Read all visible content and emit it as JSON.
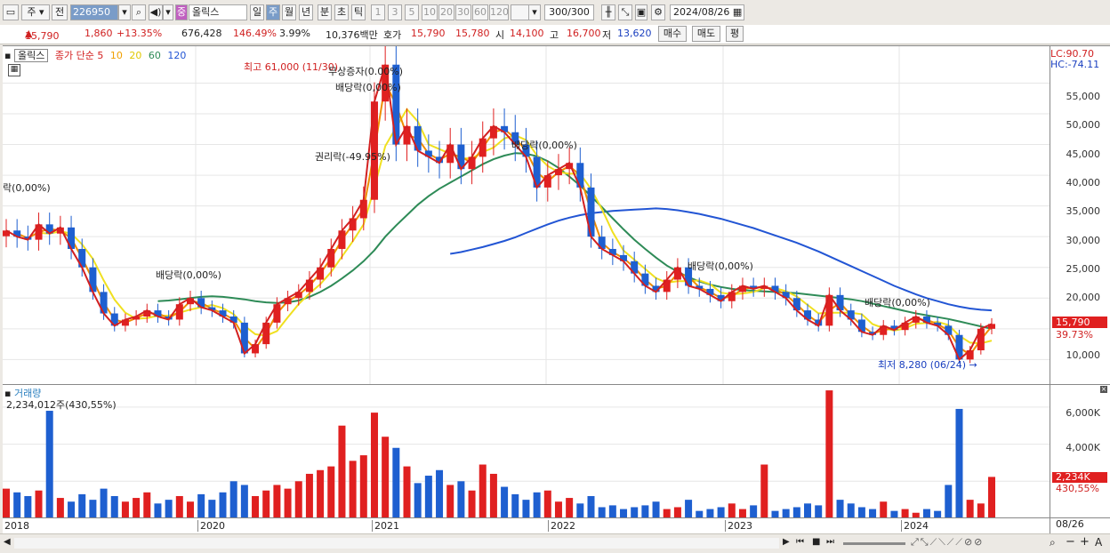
{
  "toolbar": {
    "period_type": "주",
    "prev_label": "전",
    "code": "226950",
    "stock_badge": "중",
    "stock_name": "올릭스",
    "periods": [
      "일",
      "주",
      "월",
      "년",
      "분",
      "초",
      "틱"
    ],
    "active_period": "주",
    "intervals": [
      "1",
      "3",
      "5",
      "10",
      "20",
      "30",
      "60",
      "120"
    ],
    "count": "300/300",
    "date": "2024/08/26"
  },
  "quote": {
    "price": "15,790",
    "change": "1,860",
    "change_pct": "+13.35%",
    "volume": "676,428",
    "volume_ratio": "146.49%",
    "turnover": "3.99%",
    "trade_value": "10,376백만",
    "ask_label": "호가",
    "ask1": "15,790",
    "ask2": "15,780",
    "open_label": "시",
    "open": "14,100",
    "high_label": "고",
    "high": "16,700",
    "low_label": "저",
    "low": "13,620",
    "buy_label": "매수",
    "sell_label": "매도",
    "eval_label": "평"
  },
  "price_panel": {
    "stock_tag": "올릭스",
    "legend_prefix": "종가 단순",
    "ma_periods": [
      "5",
      "10",
      "20",
      "60",
      "120"
    ],
    "ma_colors": [
      "#d32020",
      "#f08c00",
      "#f0e020",
      "#2e8b57",
      "#2255d4"
    ],
    "lc": "LC:90.70",
    "hc": "HC:-74.11",
    "yticks": [
      "55,000",
      "50,000",
      "45,000",
      "40,000",
      "35,000",
      "30,000",
      "25,000",
      "20,000",
      "15,000",
      "10,000"
    ],
    "current_price_tag": "15,790",
    "current_pct_tag": "39.73%",
    "annotations": {
      "high": "최고 61,000 (11/30)",
      "low": "최저 8,280 (06/24)",
      "free_issue": "무상증자(0.00%)",
      "rights": "권리락(-49.95%)",
      "div_2018": "락(0,00%)",
      "div_2020a": "배당락(0,00%)",
      "div_2020b": "배당락(0,00%)",
      "div_2022": "배당락(0,00%)",
      "div_2023": "배당락(0,00%)",
      "div_2024": "배당락(0,00%)"
    }
  },
  "volume_panel": {
    "title": "거래량",
    "value": "2,234,012주(430,55%)",
    "yticks": [
      "6,000K",
      "4,000K",
      "2,000K"
    ],
    "tag_value": "2,234K",
    "tag_pct": "430,55%"
  },
  "xaxis": {
    "labels": [
      "2018",
      "2020",
      "2021",
      "2022",
      "2023",
      "2024"
    ],
    "right_label": "08/26"
  },
  "chart_data": {
    "type": "candlestick",
    "price_range": [
      6000,
      61000
    ],
    "volume_range": [
      0,
      7000000
    ],
    "close_series": [
      31000,
      30000,
      29500,
      32000,
      30500,
      31500,
      28000,
      25000,
      21000,
      17500,
      15500,
      16500,
      17000,
      18000,
      17000,
      16500,
      19000,
      20000,
      18500,
      18000,
      17000,
      16000,
      11000,
      12500,
      16000,
      19000,
      20000,
      21000,
      23000,
      25000,
      28000,
      31000,
      33000,
      36000,
      52000,
      58000,
      45000,
      48000,
      44000,
      43000,
      42000,
      45000,
      41000,
      43000,
      46000,
      48000,
      47000,
      45000,
      43000,
      38000,
      40000,
      41000,
      42000,
      38000,
      30000,
      28000,
      27000,
      26000,
      24000,
      22000,
      21000,
      23000,
      25000,
      22000,
      21500,
      20500,
      19500,
      21000,
      22000,
      21500,
      22000,
      21000,
      20000,
      18000,
      16500,
      15500,
      20500,
      18000,
      16500,
      14500,
      14000,
      15500,
      14800,
      16000,
      17000,
      16000,
      15500,
      14000,
      10000,
      11500,
      15000,
      15790
    ],
    "ma60": [
      null,
      null,
      null,
      null,
      null,
      null,
      null,
      null,
      null,
      null,
      null,
      null,
      null,
      null,
      19500,
      19600,
      19800,
      20000,
      20200,
      20300,
      20200,
      20000,
      19800,
      19500,
      19300,
      19200,
      19300,
      19600,
      20200,
      21000,
      22000,
      23200,
      24500,
      26000,
      27800,
      30000,
      31800,
      33500,
      35200,
      36600,
      37800,
      38800,
      39800,
      40800,
      41800,
      42600,
      43200,
      43600,
      43500,
      43100,
      42300,
      41200,
      39800,
      38300,
      36600,
      34800,
      33000,
      31200,
      29500,
      28000,
      26600,
      25300,
      24300,
      23400,
      22700,
      22200,
      21800,
      21500,
      21300,
      21200,
      21100,
      21000,
      20900,
      20800,
      20600,
      20400,
      20200,
      20000,
      19800,
      19500,
      19100,
      18700,
      18300,
      17900,
      17500,
      17200,
      16900,
      16600,
      16200,
      15800,
      15400,
      15000
    ],
    "ma120": [
      null,
      null,
      null,
      null,
      null,
      null,
      null,
      null,
      null,
      null,
      null,
      null,
      null,
      null,
      null,
      null,
      null,
      null,
      null,
      null,
      null,
      null,
      null,
      null,
      null,
      null,
      null,
      null,
      null,
      null,
      null,
      null,
      null,
      null,
      null,
      null,
      null,
      null,
      null,
      null,
      null,
      27200,
      27500,
      27900,
      28300,
      28800,
      29300,
      29900,
      30600,
      31300,
      32000,
      32600,
      33100,
      33500,
      33800,
      34000,
      34200,
      34300,
      34400,
      34500,
      34600,
      34500,
      34300,
      34000,
      33700,
      33300,
      32900,
      32400,
      31900,
      31400,
      30800,
      30200,
      29600,
      29000,
      28300,
      27600,
      26800,
      26000,
      25200,
      24400,
      23600,
      22800,
      22000,
      21300,
      20600,
      20000,
      19500,
      19000,
      18600,
      18300,
      18100,
      18000
    ],
    "volume_values": [
      1600000,
      1400000,
      1200000,
      1500000,
      5800000,
      1100000,
      900000,
      1300000,
      1000000,
      1600000,
      1200000,
      900000,
      1100000,
      1400000,
      800000,
      1000000,
      1200000,
      900000,
      1300000,
      1000000,
      1400000,
      2000000,
      1800000,
      1200000,
      1500000,
      1800000,
      1600000,
      2000000,
      2400000,
      2600000,
      2800000,
      5000000,
      3100000,
      3400000,
      5700000,
      4400000,
      3800000,
      2800000,
      1900000,
      2300000,
      2600000,
      1800000,
      2000000,
      1500000,
      2900000,
      2400000,
      1700000,
      1300000,
      1000000,
      1400000,
      1500000,
      900000,
      1100000,
      800000,
      1200000,
      600000,
      700000,
      500000,
      600000,
      700000,
      900000,
      500000,
      600000,
      1000000,
      400000,
      500000,
      600000,
      800000,
      500000,
      700000,
      2900000,
      400000,
      500000,
      600000,
      800000,
      700000,
      6900000,
      1000000,
      800000,
      600000,
      500000,
      900000,
      400000,
      500000,
      300000,
      500000,
      400000,
      1800000,
      5900000,
      1000000,
      800000,
      2234012
    ]
  }
}
